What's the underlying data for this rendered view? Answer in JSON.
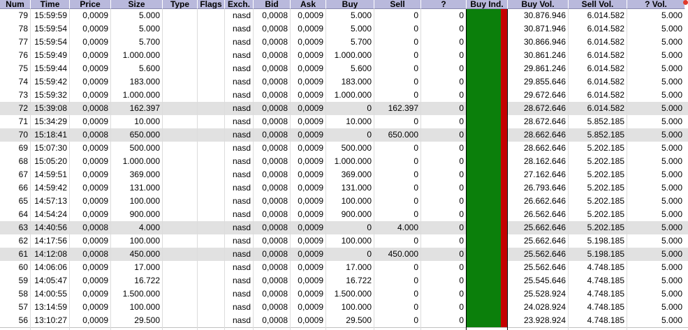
{
  "columns": [
    "Num",
    "Time",
    "Price",
    "Size",
    "Type",
    "Flags",
    "Exch.",
    "Bid",
    "Ask",
    "Buy",
    "Sell",
    "?",
    "Buy Ind.",
    "Buy Vol.",
    "Sell Vol.",
    "? Vol."
  ],
  "rows": [
    {
      "num": "79",
      "time": "15:59:59",
      "price": "0,0009",
      "size": "5.000",
      "type": "",
      "flags": "",
      "exch": "nasd",
      "bid": "0,0008",
      "ask": "0,0009",
      "buy": "5.000",
      "sell": "0",
      "q": "0",
      "buy_vol": "30.876.946",
      "sell_vol": "6.014.582",
      "q_vol": "5.000",
      "highlight": false
    },
    {
      "num": "78",
      "time": "15:59:54",
      "price": "0,0009",
      "size": "5.000",
      "type": "",
      "flags": "",
      "exch": "nasd",
      "bid": "0,0008",
      "ask": "0,0009",
      "buy": "5.000",
      "sell": "0",
      "q": "0",
      "buy_vol": "30.871.946",
      "sell_vol": "6.014.582",
      "q_vol": "5.000",
      "highlight": false
    },
    {
      "num": "77",
      "time": "15:59:54",
      "price": "0,0009",
      "size": "5.700",
      "type": "",
      "flags": "",
      "exch": "nasd",
      "bid": "0,0008",
      "ask": "0,0009",
      "buy": "5.700",
      "sell": "0",
      "q": "0",
      "buy_vol": "30.866.946",
      "sell_vol": "6.014.582",
      "q_vol": "5.000",
      "highlight": false
    },
    {
      "num": "76",
      "time": "15:59:49",
      "price": "0,0009",
      "size": "1.000.000",
      "type": "",
      "flags": "",
      "exch": "nasd",
      "bid": "0,0008",
      "ask": "0,0009",
      "buy": "1.000.000",
      "sell": "0",
      "q": "0",
      "buy_vol": "30.861.246",
      "sell_vol": "6.014.582",
      "q_vol": "5.000",
      "highlight": false
    },
    {
      "num": "75",
      "time": "15:59:44",
      "price": "0,0009",
      "size": "5.600",
      "type": "",
      "flags": "",
      "exch": "nasd",
      "bid": "0,0008",
      "ask": "0,0009",
      "buy": "5.600",
      "sell": "0",
      "q": "0",
      "buy_vol": "29.861.246",
      "sell_vol": "6.014.582",
      "q_vol": "5.000",
      "highlight": false
    },
    {
      "num": "74",
      "time": "15:59:42",
      "price": "0,0009",
      "size": "183.000",
      "type": "",
      "flags": "",
      "exch": "nasd",
      "bid": "0,0008",
      "ask": "0,0009",
      "buy": "183.000",
      "sell": "0",
      "q": "0",
      "buy_vol": "29.855.646",
      "sell_vol": "6.014.582",
      "q_vol": "5.000",
      "highlight": false
    },
    {
      "num": "73",
      "time": "15:59:32",
      "price": "0,0009",
      "size": "1.000.000",
      "type": "",
      "flags": "",
      "exch": "nasd",
      "bid": "0,0008",
      "ask": "0,0009",
      "buy": "1.000.000",
      "sell": "0",
      "q": "0",
      "buy_vol": "29.672.646",
      "sell_vol": "6.014.582",
      "q_vol": "5.000",
      "highlight": false
    },
    {
      "num": "72",
      "time": "15:39:08",
      "price": "0,0008",
      "size": "162.397",
      "type": "",
      "flags": "",
      "exch": "nasd",
      "bid": "0,0008",
      "ask": "0,0009",
      "buy": "0",
      "sell": "162.397",
      "q": "0",
      "buy_vol": "28.672.646",
      "sell_vol": "6.014.582",
      "q_vol": "5.000",
      "highlight": true
    },
    {
      "num": "71",
      "time": "15:34:29",
      "price": "0,0009",
      "size": "10.000",
      "type": "",
      "flags": "",
      "exch": "nasd",
      "bid": "0,0008",
      "ask": "0,0009",
      "buy": "10.000",
      "sell": "0",
      "q": "0",
      "buy_vol": "28.672.646",
      "sell_vol": "5.852.185",
      "q_vol": "5.000",
      "highlight": false
    },
    {
      "num": "70",
      "time": "15:18:41",
      "price": "0,0008",
      "size": "650.000",
      "type": "",
      "flags": "",
      "exch": "nasd",
      "bid": "0,0008",
      "ask": "0,0009",
      "buy": "0",
      "sell": "650.000",
      "q": "0",
      "buy_vol": "28.662.646",
      "sell_vol": "5.852.185",
      "q_vol": "5.000",
      "highlight": true
    },
    {
      "num": "69",
      "time": "15:07:30",
      "price": "0,0009",
      "size": "500.000",
      "type": "",
      "flags": "",
      "exch": "nasd",
      "bid": "0,0008",
      "ask": "0,0009",
      "buy": "500.000",
      "sell": "0",
      "q": "0",
      "buy_vol": "28.662.646",
      "sell_vol": "5.202.185",
      "q_vol": "5.000",
      "highlight": false
    },
    {
      "num": "68",
      "time": "15:05:20",
      "price": "0,0009",
      "size": "1.000.000",
      "type": "",
      "flags": "",
      "exch": "nasd",
      "bid": "0,0008",
      "ask": "0,0009",
      "buy": "1.000.000",
      "sell": "0",
      "q": "0",
      "buy_vol": "28.162.646",
      "sell_vol": "5.202.185",
      "q_vol": "5.000",
      "highlight": false
    },
    {
      "num": "67",
      "time": "14:59:51",
      "price": "0,0009",
      "size": "369.000",
      "type": "",
      "flags": "",
      "exch": "nasd",
      "bid": "0,0008",
      "ask": "0,0009",
      "buy": "369.000",
      "sell": "0",
      "q": "0",
      "buy_vol": "27.162.646",
      "sell_vol": "5.202.185",
      "q_vol": "5.000",
      "highlight": false
    },
    {
      "num": "66",
      "time": "14:59:42",
      "price": "0,0009",
      "size": "131.000",
      "type": "",
      "flags": "",
      "exch": "nasd",
      "bid": "0,0008",
      "ask": "0,0009",
      "buy": "131.000",
      "sell": "0",
      "q": "0",
      "buy_vol": "26.793.646",
      "sell_vol": "5.202.185",
      "q_vol": "5.000",
      "highlight": false
    },
    {
      "num": "65",
      "time": "14:57:13",
      "price": "0,0009",
      "size": "100.000",
      "type": "",
      "flags": "",
      "exch": "nasd",
      "bid": "0,0008",
      "ask": "0,0009",
      "buy": "100.000",
      "sell": "0",
      "q": "0",
      "buy_vol": "26.662.646",
      "sell_vol": "5.202.185",
      "q_vol": "5.000",
      "highlight": false
    },
    {
      "num": "64",
      "time": "14:54:24",
      "price": "0,0009",
      "size": "900.000",
      "type": "",
      "flags": "",
      "exch": "nasd",
      "bid": "0,0008",
      "ask": "0,0009",
      "buy": "900.000",
      "sell": "0",
      "q": "0",
      "buy_vol": "26.562.646",
      "sell_vol": "5.202.185",
      "q_vol": "5.000",
      "highlight": false
    },
    {
      "num": "63",
      "time": "14:40:56",
      "price": "0,0008",
      "size": "4.000",
      "type": "",
      "flags": "",
      "exch": "nasd",
      "bid": "0,0008",
      "ask": "0,0009",
      "buy": "0",
      "sell": "4.000",
      "q": "0",
      "buy_vol": "25.662.646",
      "sell_vol": "5.202.185",
      "q_vol": "5.000",
      "highlight": true
    },
    {
      "num": "62",
      "time": "14:17:56",
      "price": "0,0009",
      "size": "100.000",
      "type": "",
      "flags": "",
      "exch": "nasd",
      "bid": "0,0008",
      "ask": "0,0009",
      "buy": "100.000",
      "sell": "0",
      "q": "0",
      "buy_vol": "25.662.646",
      "sell_vol": "5.198.185",
      "q_vol": "5.000",
      "highlight": false
    },
    {
      "num": "61",
      "time": "14:12:08",
      "price": "0,0008",
      "size": "450.000",
      "type": "",
      "flags": "",
      "exch": "nasd",
      "bid": "0,0008",
      "ask": "0,0009",
      "buy": "0",
      "sell": "450.000",
      "q": "0",
      "buy_vol": "25.562.646",
      "sell_vol": "5.198.185",
      "q_vol": "5.000",
      "highlight": true
    },
    {
      "num": "60",
      "time": "14:06:06",
      "price": "0,0009",
      "size": "17.000",
      "type": "",
      "flags": "",
      "exch": "nasd",
      "bid": "0,0008",
      "ask": "0,0009",
      "buy": "17.000",
      "sell": "0",
      "q": "0",
      "buy_vol": "25.562.646",
      "sell_vol": "4.748.185",
      "q_vol": "5.000",
      "highlight": false
    },
    {
      "num": "59",
      "time": "14:05:47",
      "price": "0,0009",
      "size": "16.722",
      "type": "",
      "flags": "",
      "exch": "nasd",
      "bid": "0,0008",
      "ask": "0,0009",
      "buy": "16.722",
      "sell": "0",
      "q": "0",
      "buy_vol": "25.545.646",
      "sell_vol": "4.748.185",
      "q_vol": "5.000",
      "highlight": false
    },
    {
      "num": "58",
      "time": "14:00:55",
      "price": "0,0009",
      "size": "1.500.000",
      "type": "",
      "flags": "",
      "exch": "nasd",
      "bid": "0,0008",
      "ask": "0,0009",
      "buy": "1.500.000",
      "sell": "0",
      "q": "0",
      "buy_vol": "25.528.924",
      "sell_vol": "4.748.185",
      "q_vol": "5.000",
      "highlight": false
    },
    {
      "num": "57",
      "time": "13:14:59",
      "price": "0,0009",
      "size": "100.000",
      "type": "",
      "flags": "",
      "exch": "nasd",
      "bid": "0,0008",
      "ask": "0,0009",
      "buy": "100.000",
      "sell": "0",
      "q": "0",
      "buy_vol": "24.028.924",
      "sell_vol": "4.748.185",
      "q_vol": "5.000",
      "highlight": false
    },
    {
      "num": "56",
      "time": "13:10:27",
      "price": "0,0009",
      "size": "29.500",
      "type": "",
      "flags": "",
      "exch": "nasd",
      "bid": "0,0008",
      "ask": "0,0009",
      "buy": "29.500",
      "sell": "0",
      "q": "0",
      "buy_vol": "23.928.924",
      "sell_vol": "4.748.185",
      "q_vol": "5.000",
      "highlight": false
    }
  ],
  "colors": {
    "header_bg": "#b9b9dc",
    "highlight_row": "#e1e1e1",
    "buy_indicator": "#0b7f0b",
    "sell_indicator": "#c40000",
    "corner_dot": "#e03a2c"
  },
  "icons": {
    "corner": "red-dot-icon"
  }
}
